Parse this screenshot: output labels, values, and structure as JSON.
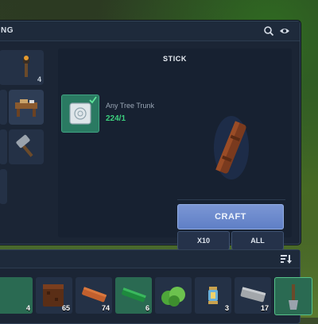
{
  "panel": {
    "title": "NG"
  },
  "header_icons": [
    "search-icon",
    "eye-icon"
  ],
  "recipes": {
    "items": [
      {
        "icon": "torch-icon",
        "count": "4"
      },
      {
        "icon": "workbench-icon",
        "count": ""
      },
      {
        "icon": "hammer-icon",
        "count": ""
      }
    ]
  },
  "detail": {
    "title": "STICK",
    "ingredient": {
      "icon": "tree-trunk-icon",
      "name": "Any Tree Trunk",
      "count": "224/1"
    },
    "preview_icon": "stick-icon",
    "craft_label": "CRAFT",
    "x10_label": "X10",
    "all_label": "ALL"
  },
  "inventory": {
    "slots": [
      {
        "icon": "green-item-icon",
        "count": "4"
      },
      {
        "icon": "dirt-block-icon",
        "count": "65"
      },
      {
        "icon": "wood-plank-icon",
        "count": "74"
      },
      {
        "icon": "green-bar-icon",
        "count": "6"
      },
      {
        "icon": "leaf-bush-icon",
        "count": ""
      },
      {
        "icon": "lantern-icon",
        "count": "3"
      },
      {
        "icon": "stone-slab-icon",
        "count": "17"
      },
      {
        "icon": "shovel-icon",
        "count": ""
      }
    ]
  },
  "colors": {
    "panel_bg": "#1b2535",
    "accent_button": "#6e8acd",
    "ingredient_ok": "#3cd07e",
    "slot_selected": "#2a7a62"
  }
}
